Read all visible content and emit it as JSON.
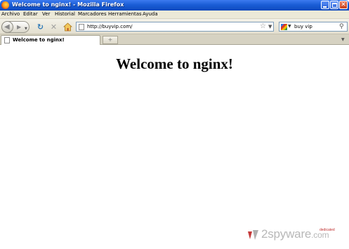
{
  "window": {
    "title": "Welcome to nginx! - Mozilla Firefox",
    "buttons": {
      "close_glyph": "✕"
    }
  },
  "menubar": {
    "items": [
      {
        "label": "Archivo"
      },
      {
        "label": "Editar"
      },
      {
        "label": "Ver"
      },
      {
        "label": "Historial"
      },
      {
        "label": "Marcadores"
      },
      {
        "label": "Herramientas"
      },
      {
        "label": "Ayuda"
      }
    ]
  },
  "toolbar": {
    "back_icon": "back-arrow-icon",
    "forward_icon": "forward-arrow-icon",
    "reload_icon": "reload-icon",
    "stop_icon": "stop-icon",
    "home_icon": "home-icon",
    "url": "http://buyvip.com/",
    "search_query": "buy vip"
  },
  "tabs": [
    {
      "label": "Welcome to nginx!"
    }
  ],
  "page": {
    "heading": "Welcome to nginx!"
  },
  "watermark": {
    "brand": "2spyware",
    "tld": ".com",
    "sub": "dedicated"
  },
  "colors": {
    "titlebar": "#1b5ed6",
    "reload": "#3a7a2a",
    "stop": "#a0a0a0",
    "home": "#e0a020"
  }
}
